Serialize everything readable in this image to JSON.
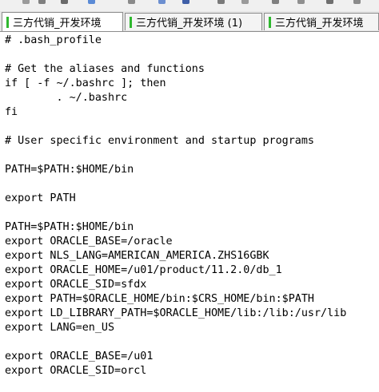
{
  "colors": {
    "tab_marker": "#2fb82f",
    "terminal_bg": "#ffffff",
    "text": "#000000",
    "tab_border": "#8c8c8c"
  },
  "tabs": [
    {
      "label": "三方代销_开发环境",
      "active": true
    },
    {
      "label": "三方代销_开发环境 (1)",
      "active": false
    },
    {
      "label": "三方代销_开发环境",
      "active": false
    }
  ],
  "terminal": {
    "lines": [
      "# .bash_profile",
      "",
      "# Get the aliases and functions",
      "if [ -f ~/.bashrc ]; then",
      "        . ~/.bashrc",
      "fi",
      "",
      "# User specific environment and startup programs",
      "",
      "PATH=$PATH:$HOME/bin",
      "",
      "export PATH",
      "",
      "PATH=$PATH:$HOME/bin",
      "export ORACLE_BASE=/oracle",
      "export NLS_LANG=AMERICAN_AMERICA.ZHS16GBK",
      "export ORACLE_HOME=/u01/product/11.2.0/db_1",
      "export ORACLE_SID=sfdx",
      "export PATH=$ORACLE_HOME/bin:$CRS_HOME/bin:$PATH",
      "export LD_LIBRARY_PATH=$ORACLE_HOME/lib:/lib:/usr/lib",
      "export LANG=en_US",
      "",
      "export ORACLE_BASE=/u01",
      "export ORACLE_SID=orcl"
    ]
  }
}
